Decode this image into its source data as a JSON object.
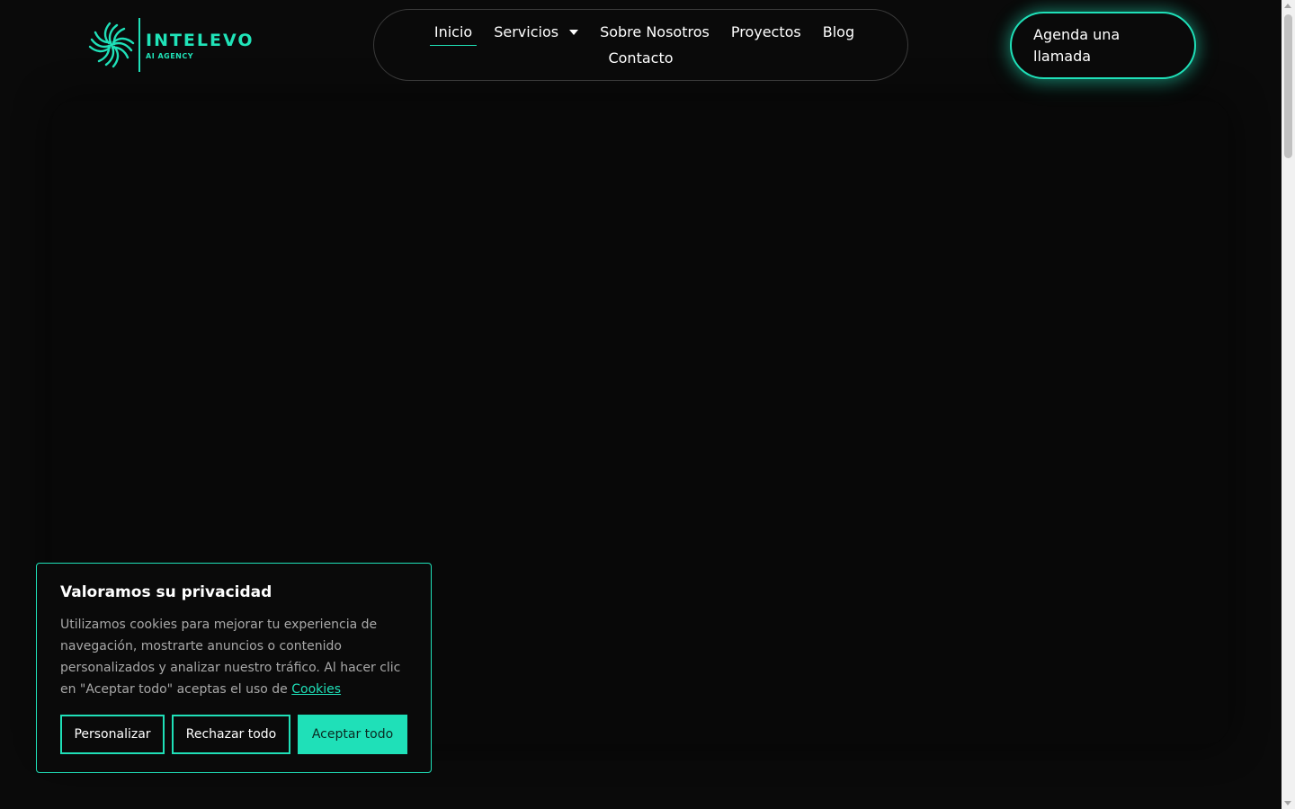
{
  "brand": {
    "name": "INTELEVO",
    "tagline": "AI AGENCY",
    "accent_color": "#1fe0b8",
    "logo_icon": "pinwheel-logo-icon"
  },
  "nav": {
    "items": [
      {
        "label": "Inicio",
        "active": true
      },
      {
        "label": "Servicios",
        "has_dropdown": true
      },
      {
        "label": "Sobre Nosotros"
      },
      {
        "label": "Proyectos"
      },
      {
        "label": "Blog"
      },
      {
        "label": "Contacto"
      }
    ]
  },
  "cta": {
    "label": "Agenda una llamada"
  },
  "cookie_banner": {
    "title": "Valoramos su privacidad",
    "body": "Utilizamos cookies para mejorar tu experiencia de navegación, mostrarte anuncios o contenido personalizados y analizar nuestro tráfico. Al hacer clic en \"Aceptar todo\" aceptas el uso de ",
    "link_label": "Cookies",
    "buttons": {
      "customize": "Personalizar",
      "reject": "Rechazar todo",
      "accept": "Aceptar todo"
    }
  }
}
